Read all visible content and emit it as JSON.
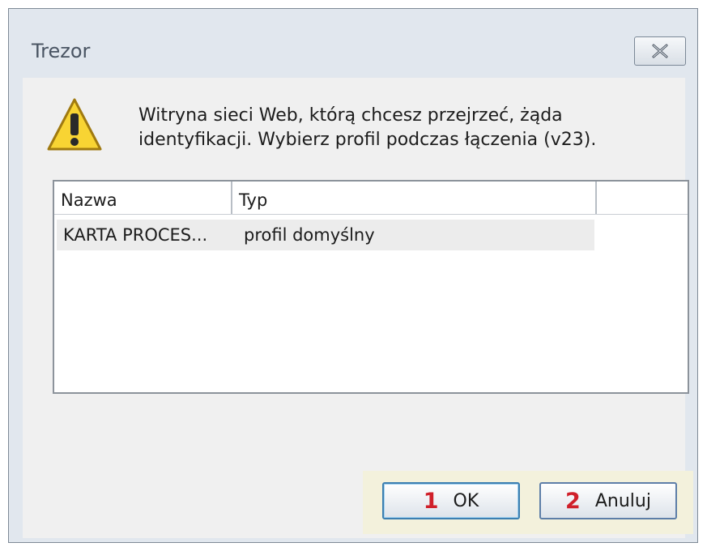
{
  "window": {
    "title": "Trezor"
  },
  "dialog": {
    "message": "Witryna sieci Web, którą chcesz przejrzeć, żąda identyfikacji. Wybierz profil podczas łączenia (v23).",
    "icon": "warning-icon"
  },
  "list": {
    "columns": [
      "Nazwa",
      "Typ"
    ],
    "rows": [
      {
        "name": "KARTA PROCES...",
        "type": "profil domyślny"
      }
    ]
  },
  "buttons": {
    "ok": {
      "number": "1",
      "label": "OK"
    },
    "cancel": {
      "number": "2",
      "label": "Anuluj"
    }
  },
  "colors": {
    "annotation_number": "#d0202a",
    "annotation_bg": "#f3f1dc"
  }
}
